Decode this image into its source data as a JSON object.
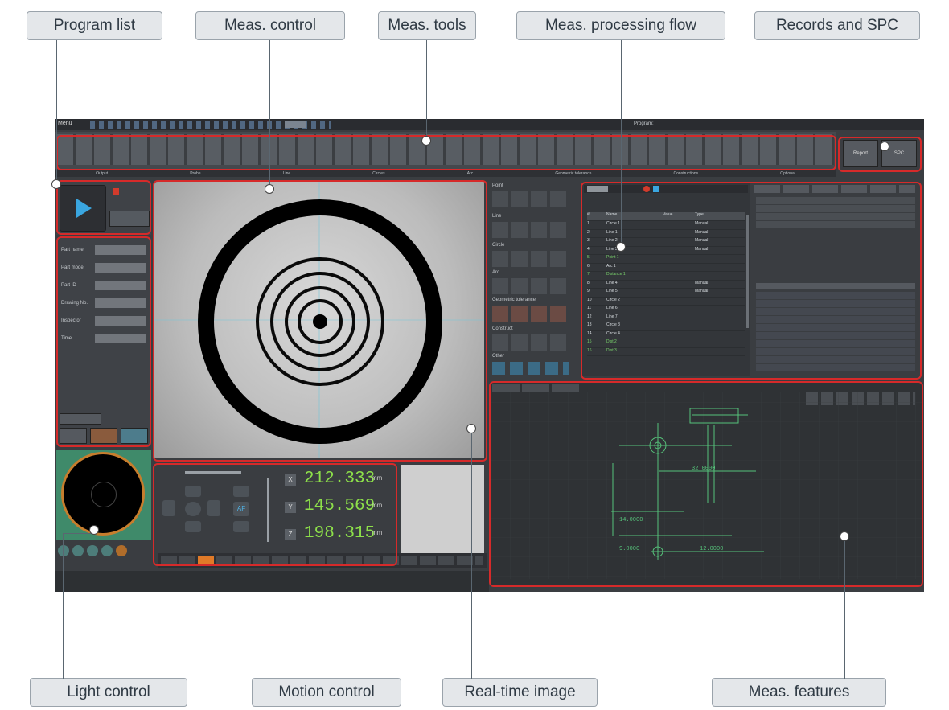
{
  "callouts": {
    "program_list": "Program list",
    "meas_control": "Meas. control",
    "meas_tools": "Meas. tools",
    "meas_processing_flow": "Meas. processing flow",
    "records_spc": "Records and SPC",
    "light_control": "Light control",
    "motion_control": "Motion control",
    "realtime_image": "Real-time image",
    "meas_features": "Meas. features"
  },
  "app": {
    "menu_label": "Menu",
    "window_title": "Program: ",
    "section_tabs": [
      "Output",
      "Probe",
      "Line",
      "Circles",
      "Arc",
      "Geometric tolerance",
      "Constructions",
      "Optional"
    ],
    "toolbar_right": [
      "Report",
      "SPC"
    ],
    "params": [
      {
        "label": "Part name",
        "value": ""
      },
      {
        "label": "Part model",
        "value": ""
      },
      {
        "label": "Part ID",
        "value": ""
      },
      {
        "label": "Drawing No.",
        "value": ""
      },
      {
        "label": "Inspector",
        "value": ""
      },
      {
        "label": "Time",
        "value": ""
      }
    ],
    "coordinates": {
      "x": "212.333",
      "y": "145.569",
      "z": "198.315",
      "unit": "mm"
    },
    "axis_labels": {
      "x": "X",
      "y": "Y",
      "z": "Z"
    },
    "af_label": "AF",
    "tools_sections": [
      "Point",
      "Line",
      "Circle",
      "Arc",
      "Geometric tolerance",
      "Construct",
      "Other"
    ],
    "table_headers": [
      "#",
      "Name",
      "Value",
      "Type"
    ],
    "table_rows": [
      [
        "1",
        "Circle 1",
        "",
        "Manual"
      ],
      [
        "2",
        "Line 1",
        "",
        "Manual"
      ],
      [
        "3",
        "Line 2",
        "",
        "Manual"
      ],
      [
        "4",
        "Line 3",
        "",
        "Manual"
      ],
      [
        "5",
        "Point 1",
        "",
        ""
      ],
      [
        "6",
        "Arc 1",
        "",
        ""
      ],
      [
        "7",
        "Distance 1",
        "",
        ""
      ],
      [
        "8",
        "Line 4",
        "",
        "Manual"
      ],
      [
        "9",
        "Line 5",
        "",
        "Manual"
      ],
      [
        "10",
        "Circle 2",
        "",
        ""
      ],
      [
        "11",
        "Line 6",
        "",
        ""
      ],
      [
        "12",
        "Line 7",
        "",
        ""
      ],
      [
        "13",
        "Circle 3",
        "",
        ""
      ],
      [
        "14",
        "Circle 4",
        "",
        ""
      ],
      [
        "15",
        "Dist 2",
        "",
        ""
      ],
      [
        "16",
        "Dist 3",
        "",
        ""
      ]
    ],
    "feature_dims": [
      "32.0000",
      "14.0000",
      "9.0000",
      "12.0000"
    ]
  }
}
